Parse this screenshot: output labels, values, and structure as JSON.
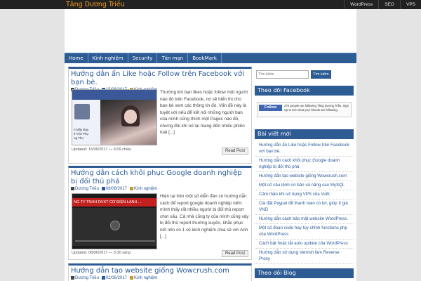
{
  "site": {
    "title": "Tăng Dương Triều"
  },
  "top_links": [
    "WordPress",
    "SEO",
    "VPS"
  ],
  "nav": [
    "Home",
    "Kinh nghiệm",
    "Security",
    "Tản mạn",
    "BookMark"
  ],
  "posts": [
    {
      "title": "Hướng dẫn ẩn Like hoặc Follow trên Facebook với bạn bè.",
      "author": "Dương Triều",
      "date": "15/06/2017",
      "category": "Kinh nghiệm",
      "excerpt": "Thường khi bạn likes hoặc follow một người nào đó trên Facebook, nó sẽ hiển thị cho bạn bè xem các thông tin đó. Vấn đề này là tuyệt vời nếu để kết nối những người bạn của mình cũng thích một Pages nào đó, nhưng đôi khi nó lại mang đến nhiều phiền toái [...]",
      "updated": "Updated: 15/06/2017 — 6:09 chiều",
      "read_label": "Read Post",
      "thumb_text": "n Mây Bay\nẻ Trời Phụ\nng Thư"
    },
    {
      "title": "Hướng dẫn cách khôi phục Google doanh nghiệp bị đối thủ phá",
      "author": "Dương Triều",
      "date": "08/06/2017",
      "category": "Kinh nghiệm",
      "excerpt": "Hiện tại trên một số diễn đàn có hướng dẫn cách để report google doanh nghiệp nếm mình thấy rất nhiều người bị đối thủ report chơi xấu. Cả nhà cũng ty của mình cũng vậy bị đối thủ report thường xuyên, khắc phục riết nên có 1 số kinh nghiệm chia sẻ với Anh [...]",
      "updated": "Updated: 08/06/2017 — 3:30 sáng",
      "read_label": "Read Post",
      "thumb_text": "NG TY TNHH DVKT CƠ ĐIỆN LẠNH ..."
    },
    {
      "title": "Hướng dẫn tạo website giống Wowcrush.com",
      "author": "Dương Triều",
      "date": "02/06/2017",
      "category": "Kinh nghiệm"
    }
  ],
  "sidebar": {
    "search_placeholder": "Tìm kiếm",
    "search_button": "Tìm kiếm",
    "facebook_title": "Theo dõi Facebook",
    "fb_button": "Follow",
    "fb_text": "27K people are following Tăng Dương Triều. Sign Up to see what your friends are following.",
    "recent_title": "Bài viết mới",
    "recent": [
      "Hướng dẫn ẩn Like hoặc Follow trên Facebook với bạn bè.",
      "Hướng dẫn cách khôi phục Google doanh nghiệp bị đối thủ phá",
      "Hướng dẫn tạo website giống Wowcrush.com",
      "Một số câu lệnh cơ bản và nâng cao MySQL",
      "Cảm thận khi sử dụng VPS của Vultr.",
      "Cài đặt Paypal để thanh toán có lợi, giúp ít giá VND",
      "Hướng dẫn cách bảo mật website WordPress.",
      "Một số đoạn code hay tùy chỉnh functions php của WordPress",
      "Cách bật hoặc tắt auto update của WordPress",
      "Hướng dẫn sử dụng Varnish làm Reverse Proxy"
    ],
    "blog_title": "Theo dõi Blog"
  }
}
